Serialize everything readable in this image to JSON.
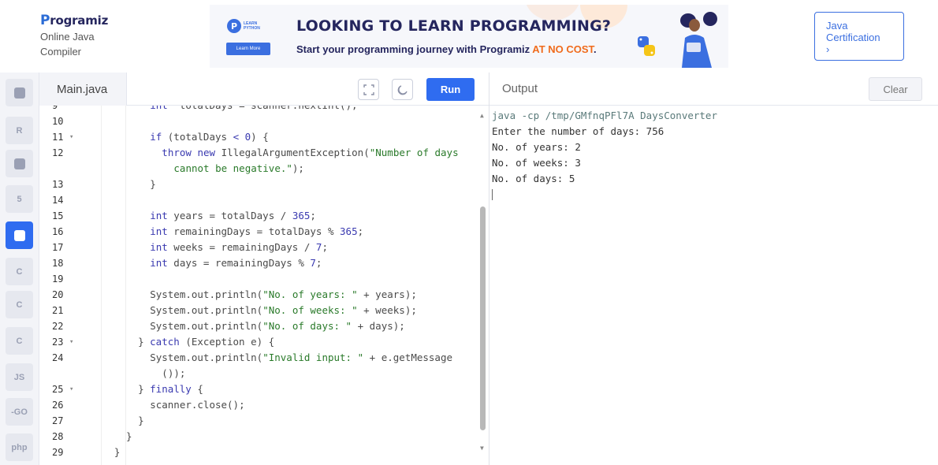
{
  "header": {
    "brand_name": "rogramiz",
    "brand_initial": "P",
    "brand_sub1": "Online Java",
    "brand_sub2": "Compiler",
    "cert_button_line1": "Java",
    "cert_button_line2": "Certification",
    "cert_button_arrow": "›"
  },
  "ad": {
    "badge_text1": "LEARN",
    "badge_text2": "PYTHON",
    "learn_button": "Learn More",
    "headline": "LOOKING TO LEARN PROGRAMMING?",
    "subline": "Start your programming journey with Programiz ",
    "subline_highlight": "AT NO COST",
    "subline_end": "."
  },
  "sidebar": {
    "items": [
      {
        "name": "python-icon",
        "label": "",
        "active": false
      },
      {
        "name": "r-icon",
        "label": "R",
        "active": false
      },
      {
        "name": "sql-icon",
        "label": "",
        "active": false
      },
      {
        "name": "html-icon",
        "label": "5",
        "active": false
      },
      {
        "name": "java-icon",
        "label": "",
        "active": true
      },
      {
        "name": "c-icon",
        "label": "C",
        "active": false
      },
      {
        "name": "cpp-icon",
        "label": "C",
        "active": false
      },
      {
        "name": "csharp-icon",
        "label": "C",
        "active": false
      },
      {
        "name": "js-icon",
        "label": "JS",
        "active": false
      },
      {
        "name": "go-icon",
        "label": "-GO",
        "active": false
      },
      {
        "name": "php-icon",
        "label": "php",
        "active": false
      }
    ]
  },
  "editor": {
    "tab_label": "Main.java",
    "run_label": "Run",
    "lines": [
      {
        "n": "9",
        "fold": false,
        "indent": 4,
        "segs": [
          [
            "kw",
            "int"
          ],
          [
            "",
            "  totalDays = scanner.nextInt();"
          ]
        ]
      },
      {
        "n": "10",
        "fold": false,
        "indent": 0,
        "segs": []
      },
      {
        "n": "11",
        "fold": true,
        "indent": 4,
        "segs": [
          [
            "kw",
            "if"
          ],
          [
            "",
            " (totalDays "
          ],
          [
            "num",
            "<"
          ],
          [
            "",
            " "
          ],
          [
            "num",
            "0"
          ],
          [
            "",
            ") {"
          ]
        ]
      },
      {
        "n": "12",
        "fold": false,
        "indent": 6,
        "segs": [
          [
            "kw",
            "throw"
          ],
          [
            "",
            " "
          ],
          [
            "kw",
            "new"
          ],
          [
            "",
            " IllegalArgumentException("
          ],
          [
            "str",
            "\"Number of days"
          ]
        ]
      },
      {
        "n": "",
        "fold": false,
        "indent": 8,
        "segs": [
          [
            "str",
            "cannot be negative.\""
          ],
          [
            "",
            ");"
          ]
        ]
      },
      {
        "n": "13",
        "fold": false,
        "indent": 4,
        "segs": [
          [
            "",
            "}"
          ]
        ]
      },
      {
        "n": "14",
        "fold": false,
        "indent": 0,
        "segs": []
      },
      {
        "n": "15",
        "fold": false,
        "indent": 4,
        "segs": [
          [
            "kw",
            "int"
          ],
          [
            "",
            " years = totalDays / "
          ],
          [
            "num",
            "365"
          ],
          [
            "",
            ";"
          ]
        ]
      },
      {
        "n": "16",
        "fold": false,
        "indent": 4,
        "segs": [
          [
            "kw",
            "int"
          ],
          [
            "",
            " remainingDays = totalDays % "
          ],
          [
            "num",
            "365"
          ],
          [
            "",
            ";"
          ]
        ]
      },
      {
        "n": "17",
        "fold": false,
        "indent": 4,
        "segs": [
          [
            "kw",
            "int"
          ],
          [
            "",
            " weeks = remainingDays / "
          ],
          [
            "num",
            "7"
          ],
          [
            "",
            ";"
          ]
        ]
      },
      {
        "n": "18",
        "fold": false,
        "indent": 4,
        "segs": [
          [
            "kw",
            "int"
          ],
          [
            "",
            " days = remainingDays % "
          ],
          [
            "num",
            "7"
          ],
          [
            "",
            ";"
          ]
        ]
      },
      {
        "n": "19",
        "fold": false,
        "indent": 0,
        "segs": []
      },
      {
        "n": "20",
        "fold": false,
        "indent": 4,
        "segs": [
          [
            "",
            "System.out.println("
          ],
          [
            "str",
            "\"No. of years: \""
          ],
          [
            "",
            " + years);"
          ]
        ]
      },
      {
        "n": "21",
        "fold": false,
        "indent": 4,
        "segs": [
          [
            "",
            "System.out.println("
          ],
          [
            "str",
            "\"No. of weeks: \""
          ],
          [
            "",
            " + weeks);"
          ]
        ]
      },
      {
        "n": "22",
        "fold": false,
        "indent": 4,
        "segs": [
          [
            "",
            "System.out.println("
          ],
          [
            "str",
            "\"No. of days: \""
          ],
          [
            "",
            " + days);"
          ]
        ]
      },
      {
        "n": "23",
        "fold": true,
        "indent": 2,
        "segs": [
          [
            "",
            "} "
          ],
          [
            "kw",
            "catch"
          ],
          [
            "",
            " (Exception e) {"
          ]
        ]
      },
      {
        "n": "24",
        "fold": false,
        "indent": 4,
        "segs": [
          [
            "",
            "System.out.println("
          ],
          [
            "str",
            "\"Invalid input: \""
          ],
          [
            "",
            " + e.getMessage"
          ]
        ]
      },
      {
        "n": "",
        "fold": false,
        "indent": 6,
        "segs": [
          [
            "",
            "());"
          ]
        ]
      },
      {
        "n": "25",
        "fold": true,
        "indent": 2,
        "segs": [
          [
            "",
            "} "
          ],
          [
            "kw",
            "finally"
          ],
          [
            "",
            " {"
          ]
        ]
      },
      {
        "n": "26",
        "fold": false,
        "indent": 4,
        "segs": [
          [
            "",
            "scanner.close();"
          ]
        ]
      },
      {
        "n": "27",
        "fold": false,
        "indent": 2,
        "segs": [
          [
            "",
            "}"
          ]
        ]
      },
      {
        "n": "28",
        "fold": false,
        "indent": 0,
        "segs": [
          [
            "",
            "}"
          ]
        ]
      },
      {
        "n": "29",
        "fold": false,
        "indent": -2,
        "segs": [
          [
            "",
            "}"
          ]
        ]
      }
    ]
  },
  "output": {
    "title": "Output",
    "clear_label": "Clear",
    "lines": [
      {
        "cls": "cmd",
        "text": "java -cp /tmp/GMfnqPFl7A DaysConverter"
      },
      {
        "cls": "",
        "text": "Enter the number of days: 756"
      },
      {
        "cls": "",
        "text": "No. of years: 2"
      },
      {
        "cls": "",
        "text": "No. of weeks: 3"
      },
      {
        "cls": "",
        "text": "No. of days: 5"
      }
    ]
  },
  "colors": {
    "accent": "#2f6cf0",
    "keyword": "#3a3ab0",
    "string": "#2a7a2a",
    "cta_orange": "#f06b1c"
  }
}
